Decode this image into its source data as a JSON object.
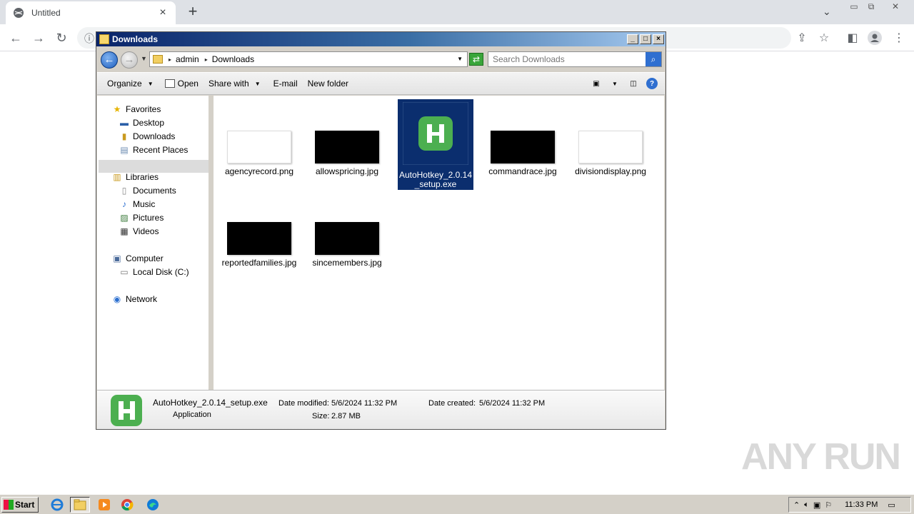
{
  "browser": {
    "tab_title": "Untitled",
    "new_tab_symbol": "+",
    "tab_close_symbol": "×"
  },
  "explorer": {
    "title": "Downloads",
    "breadcrumbs": [
      "admin",
      "Downloads"
    ],
    "search_placeholder": "Search Downloads",
    "commands": {
      "organize": "Organize",
      "open": "Open",
      "share_with": "Share with",
      "email": "E-mail",
      "new_folder": "New folder"
    },
    "nav": {
      "favorites": "Favorites",
      "desktop": "Desktop",
      "downloads": "Downloads",
      "recent_places": "Recent Places",
      "libraries": "Libraries",
      "documents": "Documents",
      "music": "Music",
      "pictures": "Pictures",
      "videos": "Videos",
      "computer": "Computer",
      "local_disk": "Local Disk (C:)",
      "network": "Network"
    },
    "files": [
      {
        "name": "agencyrecord.png",
        "thumb": "white"
      },
      {
        "name": "allowspricing.jpg",
        "thumb": "black"
      },
      {
        "name": "AutoHotkey_2.0.14_setup.exe",
        "thumb": "ahk",
        "selected": true
      },
      {
        "name": "commandrace.jpg",
        "thumb": "black"
      },
      {
        "name": "divisiondisplay.png",
        "thumb": "white"
      },
      {
        "name": "reportedfamilies.jpg",
        "thumb": "black"
      },
      {
        "name": "sincemembers.jpg",
        "thumb": "black"
      }
    ],
    "details": {
      "name": "AutoHotkey_2.0.14_setup.exe",
      "type": "Application",
      "date_modified_label": "Date modified:",
      "date_modified": "5/6/2024 11:32 PM",
      "date_created_label": "Date created:",
      "date_created": "5/6/2024 11:32 PM",
      "size_label": "Size:",
      "size": "2.87 MB"
    }
  },
  "taskbar": {
    "start_label": "Start",
    "clock": "11:33 PM"
  },
  "watermark": "ANY RUN",
  "colors": {
    "ahk_green": "#4caf50",
    "selection": "#0b2e6e"
  }
}
